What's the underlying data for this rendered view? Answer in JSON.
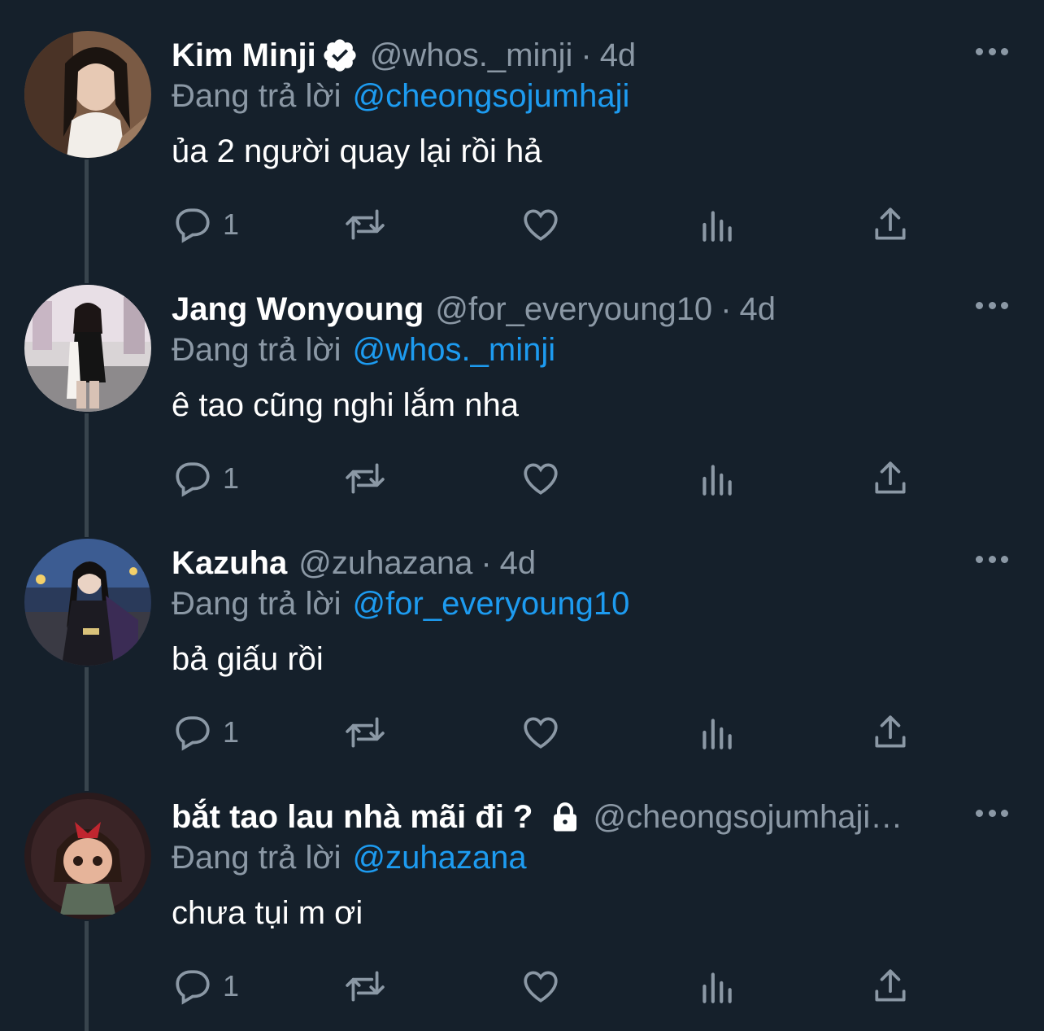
{
  "reply_prefix": "Đang trả lời",
  "tweets": [
    {
      "display_name": "Kim Minji",
      "handle": "@whos._minji",
      "separator": "·",
      "time": "4d",
      "reply_to": "@cheongsojumhaji",
      "text": "ủa 2 người quay lại rồi hả",
      "reply_count": "1",
      "verified": true
    },
    {
      "display_name": "Jang Wonyoung",
      "handle": "@for_everyoung10",
      "separator": "·",
      "time": "4d",
      "reply_to": "@whos._minji",
      "text": "ê tao cũng nghi lắm nha",
      "reply_count": "1"
    },
    {
      "display_name": "Kazuha",
      "handle": "@zuhazana",
      "separator": "·",
      "time": "4d",
      "reply_to": "@for_everyoung10",
      "text": "bả giấu rồi",
      "reply_count": "1"
    },
    {
      "display_name": "bắt tao lau nhà mãi đi ?",
      "handle": "@cheongsojumhaji…",
      "reply_to": "@zuhazana",
      "text": "chưa tụi m ơi",
      "reply_count": "1",
      "protected": true
    }
  ],
  "icons": {
    "reply": "reply-icon",
    "retweet": "retweet-icon",
    "like": "heart-icon",
    "views": "analytics-icon",
    "share": "share-icon",
    "more": "more-icon",
    "verified": "verified-badge-icon",
    "protected": "lock-icon"
  },
  "colors": {
    "background": "#15202b",
    "link": "#1d9bf0",
    "secondary": "#8b98a5",
    "thread_line": "#38444d"
  }
}
